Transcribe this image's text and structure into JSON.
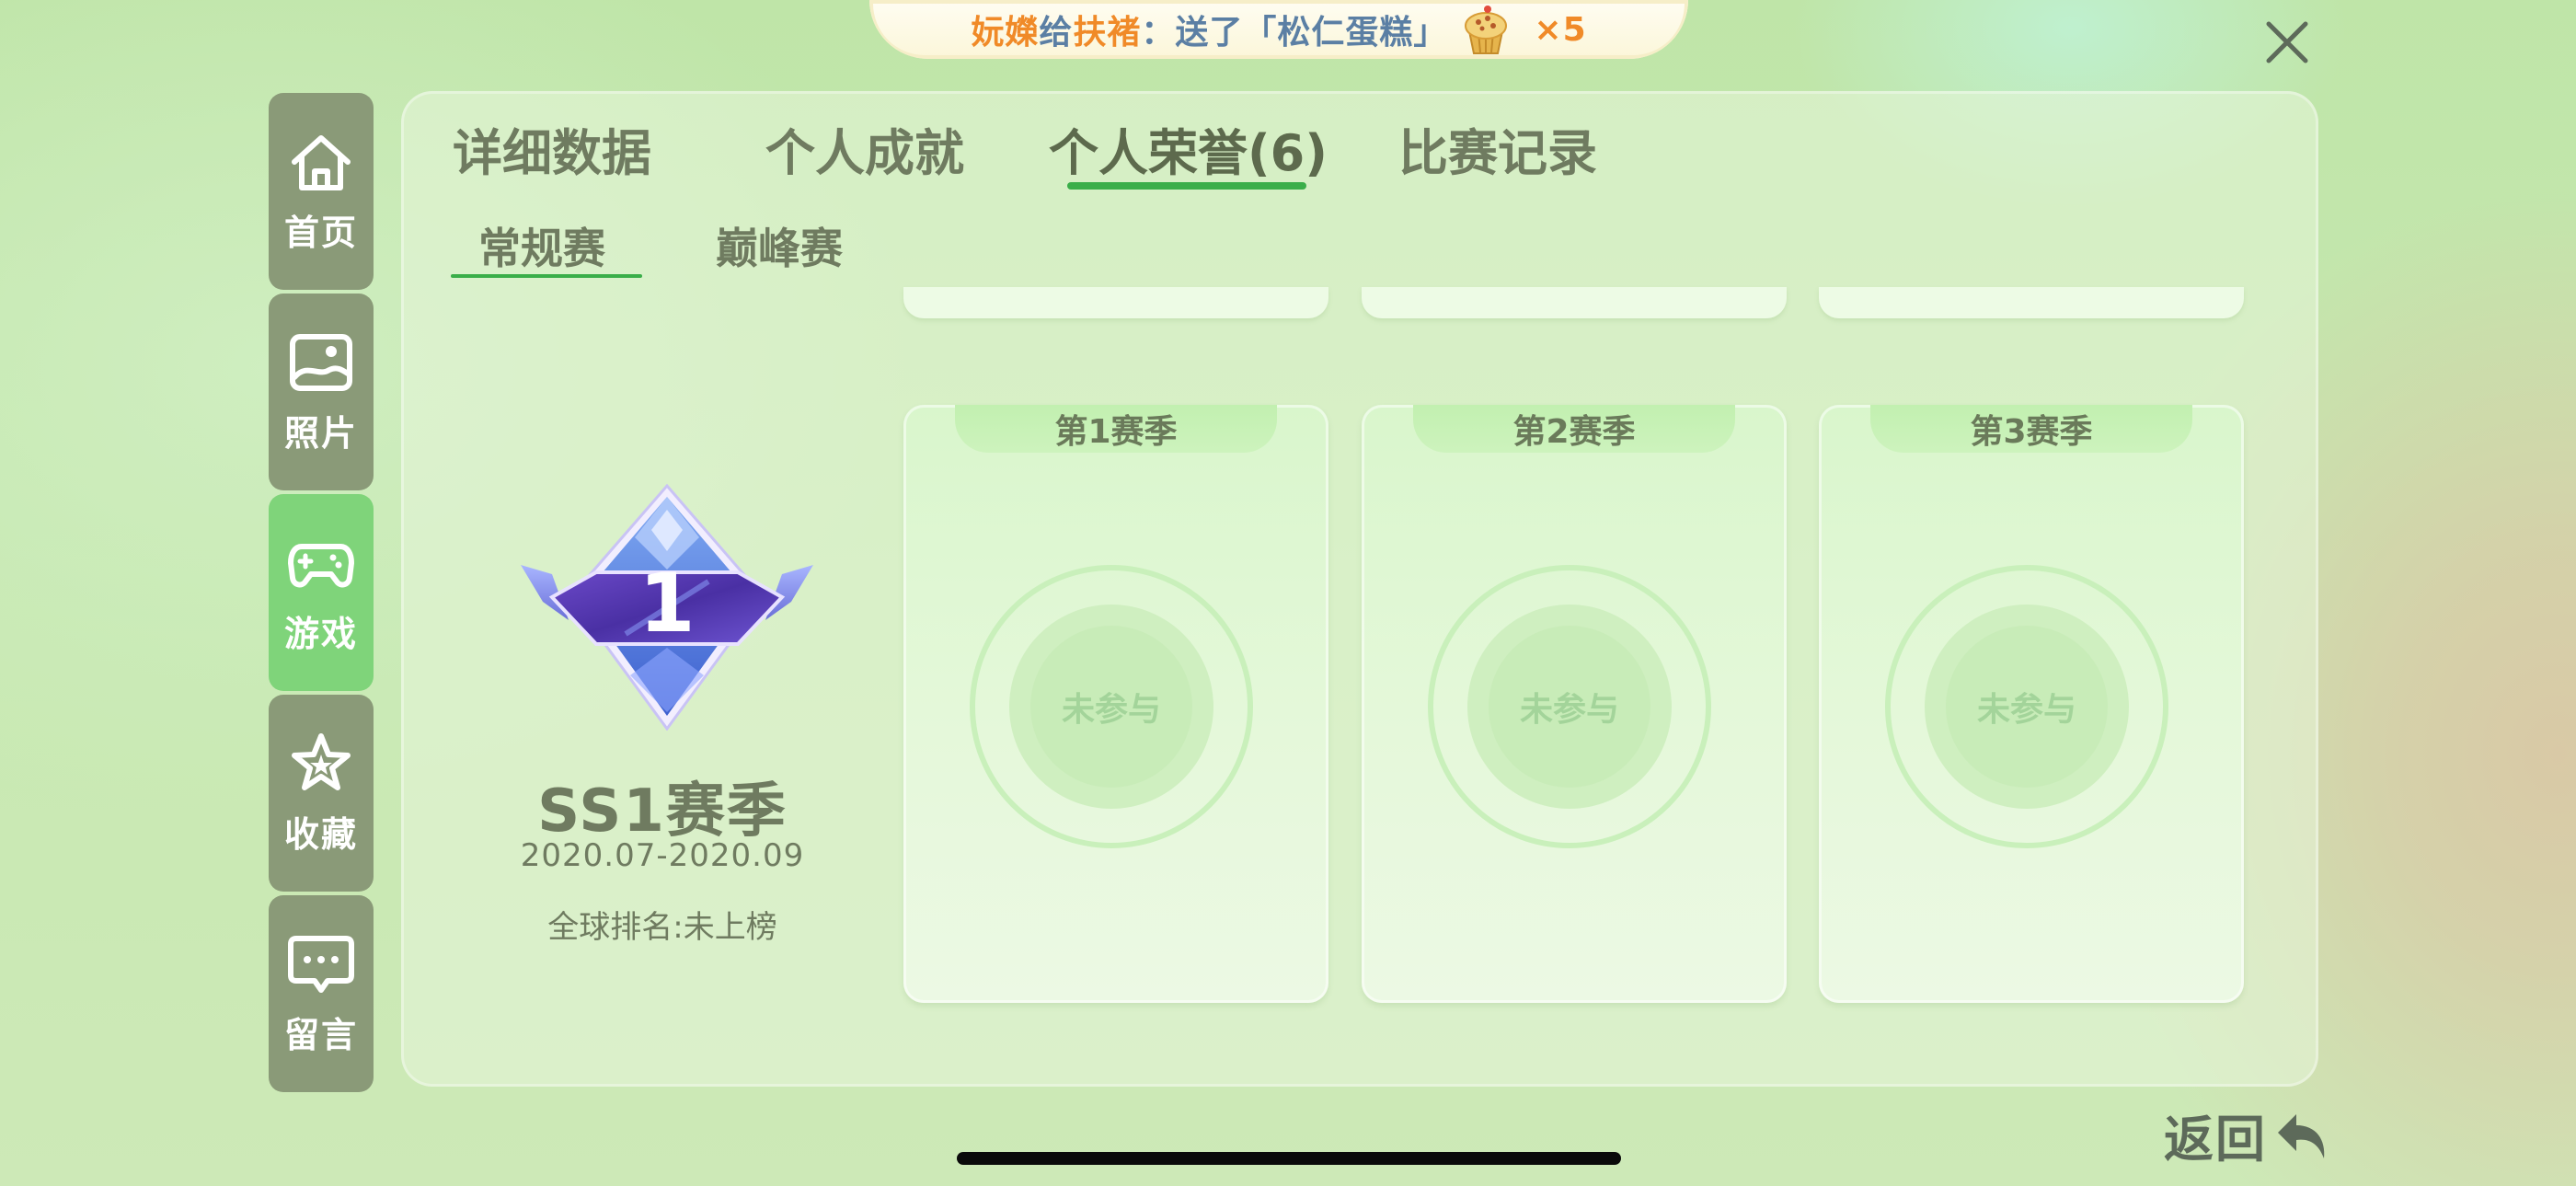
{
  "banner": {
    "sender": "妧嬫",
    "verb1": "给",
    "receiver": "扶褚",
    "verb2": "：送了「松仁蛋糕」",
    "gift_icon": "cupcake-icon",
    "count": "×5"
  },
  "sidebar": {
    "items": [
      {
        "label": "首页",
        "icon": "home-icon",
        "active": false
      },
      {
        "label": "照片",
        "icon": "photo-icon",
        "active": false
      },
      {
        "label": "游戏",
        "icon": "gamepad-icon",
        "active": true
      },
      {
        "label": "收藏",
        "icon": "star-icon",
        "active": false
      },
      {
        "label": "留言",
        "icon": "message-icon",
        "active": false
      }
    ]
  },
  "tabs": [
    {
      "label": "详细数据",
      "active": false
    },
    {
      "label": "个人成就",
      "active": false
    },
    {
      "label": "个人荣誉(6)",
      "active": true
    },
    {
      "label": "比赛记录",
      "active": false
    }
  ],
  "subtabs": [
    {
      "label": "常规赛",
      "active": true
    },
    {
      "label": "巅峰赛",
      "active": false
    }
  ],
  "season": {
    "badge_number": "1",
    "title": "SS1赛季",
    "dates": "2020.07-2020.09",
    "rank": "全球排名:未上榜"
  },
  "cards": [
    {
      "title": "第1赛季",
      "status": "未参与"
    },
    {
      "title": "第2赛季",
      "status": "未参与"
    },
    {
      "title": "第3赛季",
      "status": "未参与"
    }
  ],
  "back": {
    "label": "返回",
    "icon": "return-arrow-icon"
  },
  "colors": {
    "accent_green": "#3aae49",
    "sidebar_bg": "#8a9a78",
    "sidebar_active": "#7fd47a",
    "banner_orange": "#f08a28",
    "banner_blue": "#5b7fa4",
    "badge_purple": "#5b3fb0"
  }
}
